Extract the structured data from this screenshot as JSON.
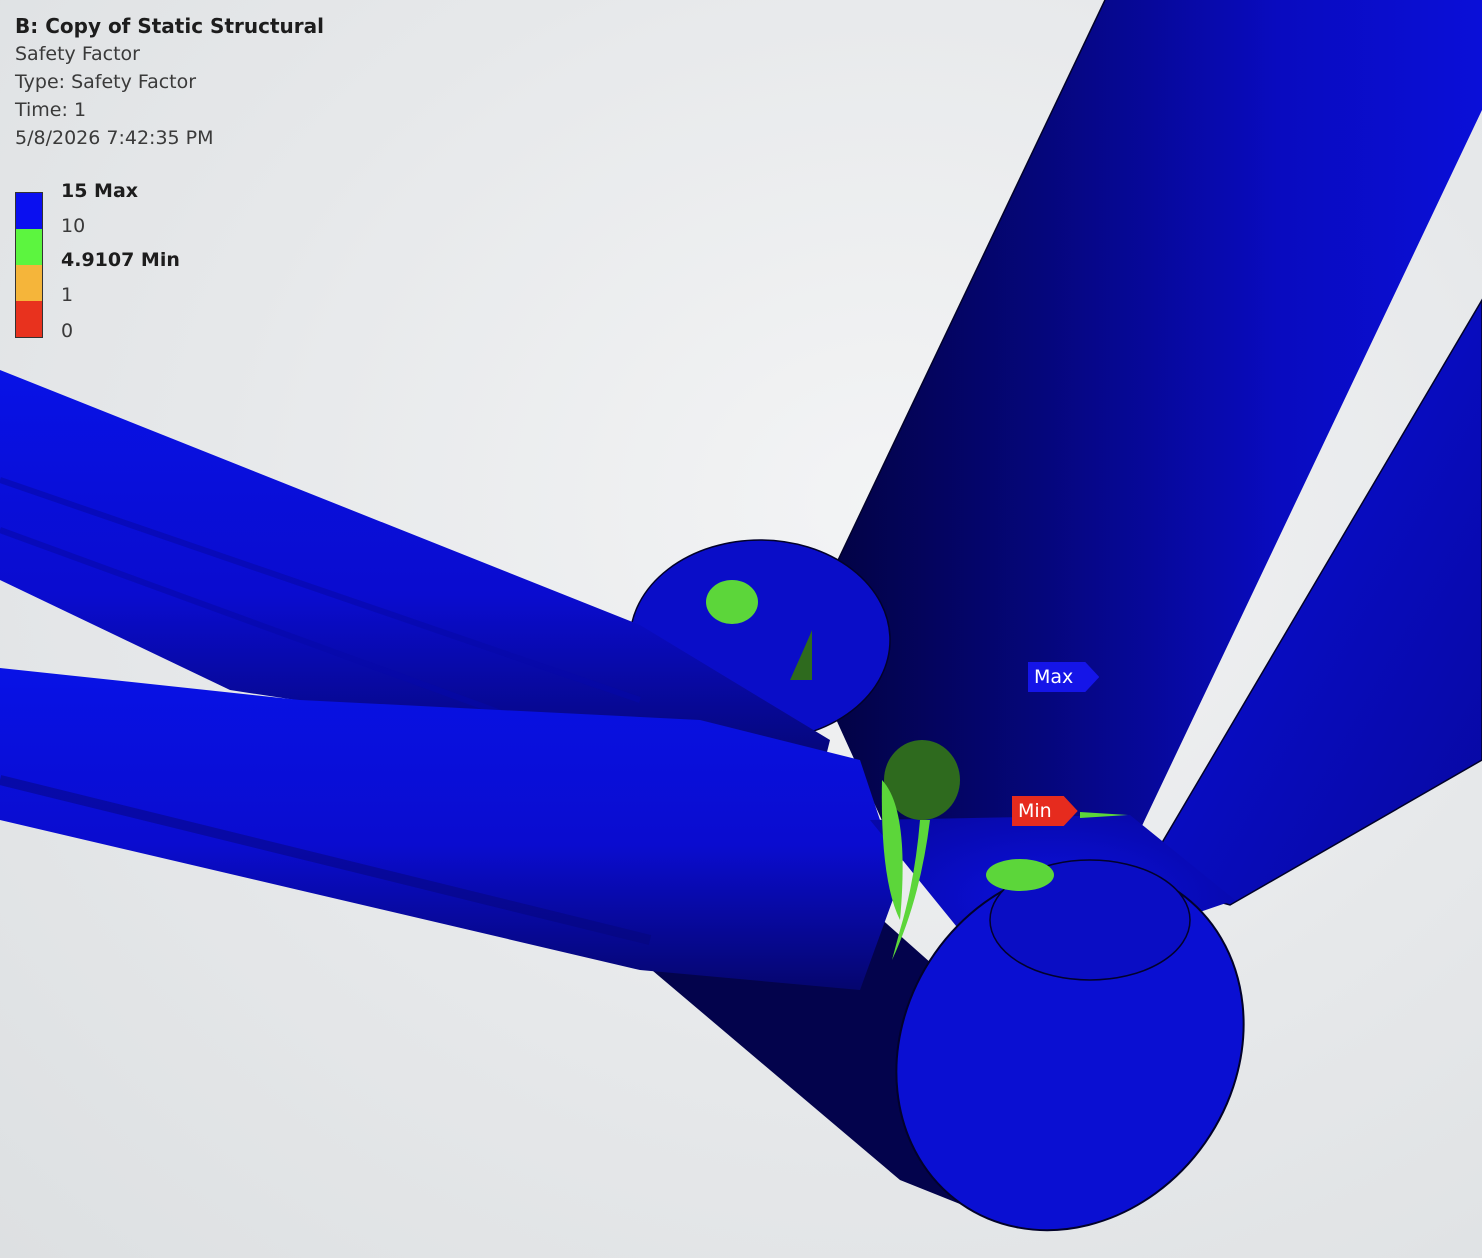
{
  "header": {
    "title": "B: Copy of Static Structural",
    "result_name": "Safety Factor",
    "type_line": "Type: Safety Factor",
    "time_line": "Time: 1",
    "date_line": "5/8/2026 7:42:35 PM"
  },
  "legend": {
    "labels": [
      "15 Max",
      "10",
      "4.9107 Min",
      "1",
      "0"
    ],
    "colors": [
      "#0a0ff0",
      "#5cf53f",
      "#f5b53a",
      "#e8321e"
    ]
  },
  "probes": {
    "max_label": "Max",
    "min_label": "Min",
    "max_color": "#1515e8",
    "min_color": "#e62b1e"
  },
  "colors": {
    "tube_blue": "#0a0fd8",
    "tube_shadow": "#03034a",
    "hotspot_green": "#5cd63a",
    "hotspot_dark_green": "#2e6a1e"
  }
}
